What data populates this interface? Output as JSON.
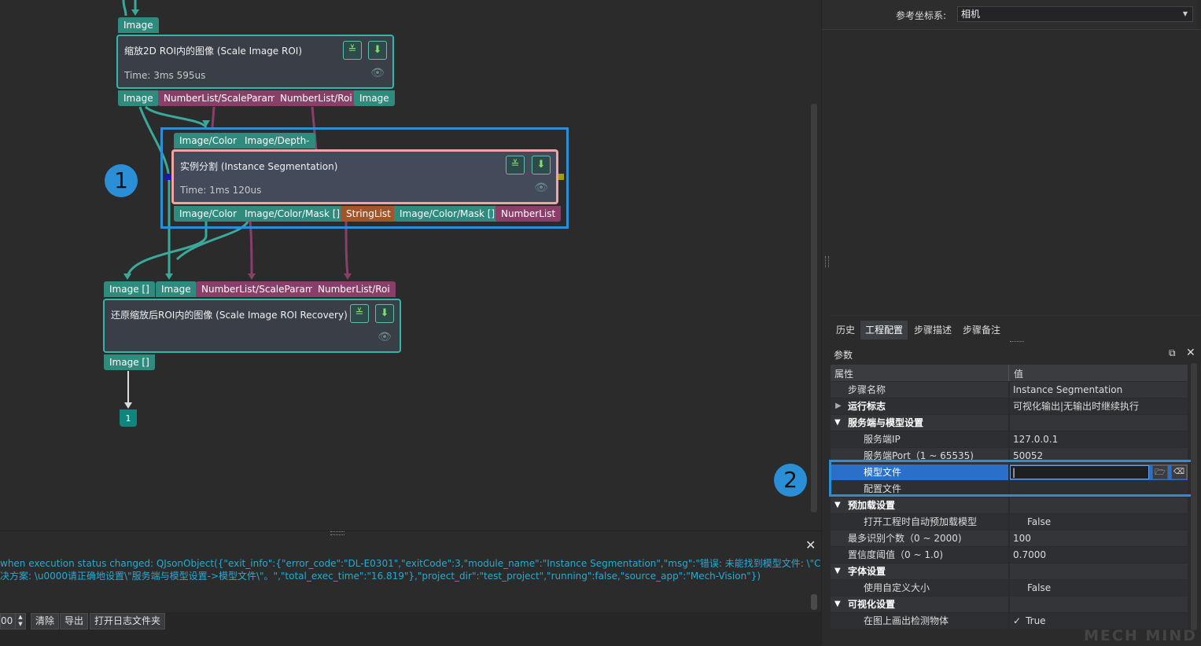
{
  "node1": {
    "in_port": "Image",
    "title": "缩放2D ROI内的图像 (Scale Image ROI)",
    "time": "Time: 3ms 595us",
    "out_ports": [
      "Image",
      "NumberList/ScaleParam",
      "NumberList/Roi",
      "Image"
    ]
  },
  "node2": {
    "in_ports": [
      "Image/Color",
      "Image/Depth-"
    ],
    "title": "实例分割 (Instance Segmentation)",
    "time": "Time: 1ms 120us",
    "out_ports": [
      "Image/Color",
      "Image/Color/Mask []",
      "StringList",
      "Image/Color/Mask []",
      "NumberList"
    ]
  },
  "node3": {
    "in_ports": [
      "Image []",
      "Image",
      "NumberList/ScaleParam",
      "NumberList/Roi"
    ],
    "title": "还原缩放后ROI内的图像 (Scale Image ROI Recovery)",
    "out_port": "Image []"
  },
  "output_badge": "1",
  "callouts": {
    "one": "1",
    "two": "2"
  },
  "top_right": {
    "label": "参考坐标系:",
    "value": "相机"
  },
  "tabs": [
    "历史",
    "工程配置",
    "步骤描述",
    "步骤备注"
  ],
  "params_panel": {
    "title": "参数",
    "header_key": "属性",
    "header_value": "值",
    "rows": [
      {
        "k": "步骤名称",
        "v": "Instance Segmentation"
      },
      {
        "k": "运行标志",
        "v": "可视化输出|无输出时继续执行"
      },
      {
        "k": "服务端与模型设置",
        "v": ""
      },
      {
        "k": "服务端IP",
        "v": "127.0.0.1"
      },
      {
        "k": "服务端Port（1 ~ 65535)",
        "v": "50052"
      },
      {
        "k": "模型文件",
        "v": ""
      },
      {
        "k": "配置文件",
        "v": ""
      },
      {
        "k": "预加载设置",
        "v": ""
      },
      {
        "k": "打开工程时自动预加载模型",
        "v": "False"
      },
      {
        "k": "最多识别个数（0 ~ 2000)",
        "v": "100"
      },
      {
        "k": "置信度阈值（0 ~ 1.0)",
        "v": "0.7000"
      },
      {
        "k": "字体设置",
        "v": ""
      },
      {
        "k": "使用自定义大小",
        "v": "False"
      },
      {
        "k": "可视化设置",
        "v": ""
      },
      {
        "k": "在图上画出检测物体",
        "v": "True"
      }
    ]
  },
  "log": {
    "line1": "when execution status changed: QJsonObject({\"exit_info\":{\"error_code\":\"DL-E0301\",\"exitCode\":3,\"module_name\":\"Instance Segmentation\",\"msg\":\"错误: 未能找到模型文件: \\\"C:/Users/CST/",
    "line2": "决方案: \\u0000请正确地设置\\\"服务端与模型设置->模型文件\\\"。\",\"total_exec_time\":\"16.819\"},\"project_dir\":\"test_project\",\"running\":false,\"source_app\":\"Mech-Vision\"})",
    "spin_value": "00",
    "buttons": [
      "清除",
      "导出",
      "打开日志文件夹"
    ]
  },
  "watermark": "MECH MIND",
  "colors": {
    "accent_blue": "#2a8fd6",
    "node_border": "#2fb8a7",
    "highlight_pink": "#f2a4a4",
    "selected_row": "#2a6fc9"
  }
}
